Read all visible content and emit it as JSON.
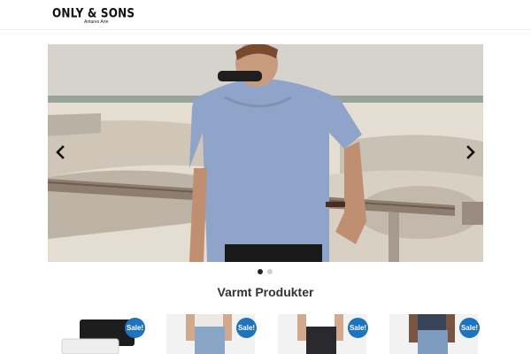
{
  "header": {
    "logo_main": "ONLY & SONS",
    "logo_sub": "Antares Arte"
  },
  "slider": {
    "prev_icon": "chevron-left-icon",
    "next_icon": "chevron-right-icon",
    "active_slide": 1,
    "slide_count": 2
  },
  "section": {
    "title": "Varmt Produkter"
  },
  "products": [
    {
      "badge": "Sale!"
    },
    {
      "badge": "Sale!"
    },
    {
      "badge": "Sale!"
    },
    {
      "badge": "Sale!"
    }
  ],
  "colors": {
    "badge": "#1e73be",
    "dot_active": "#222222",
    "dot_inactive": "#cfcfcf"
  }
}
